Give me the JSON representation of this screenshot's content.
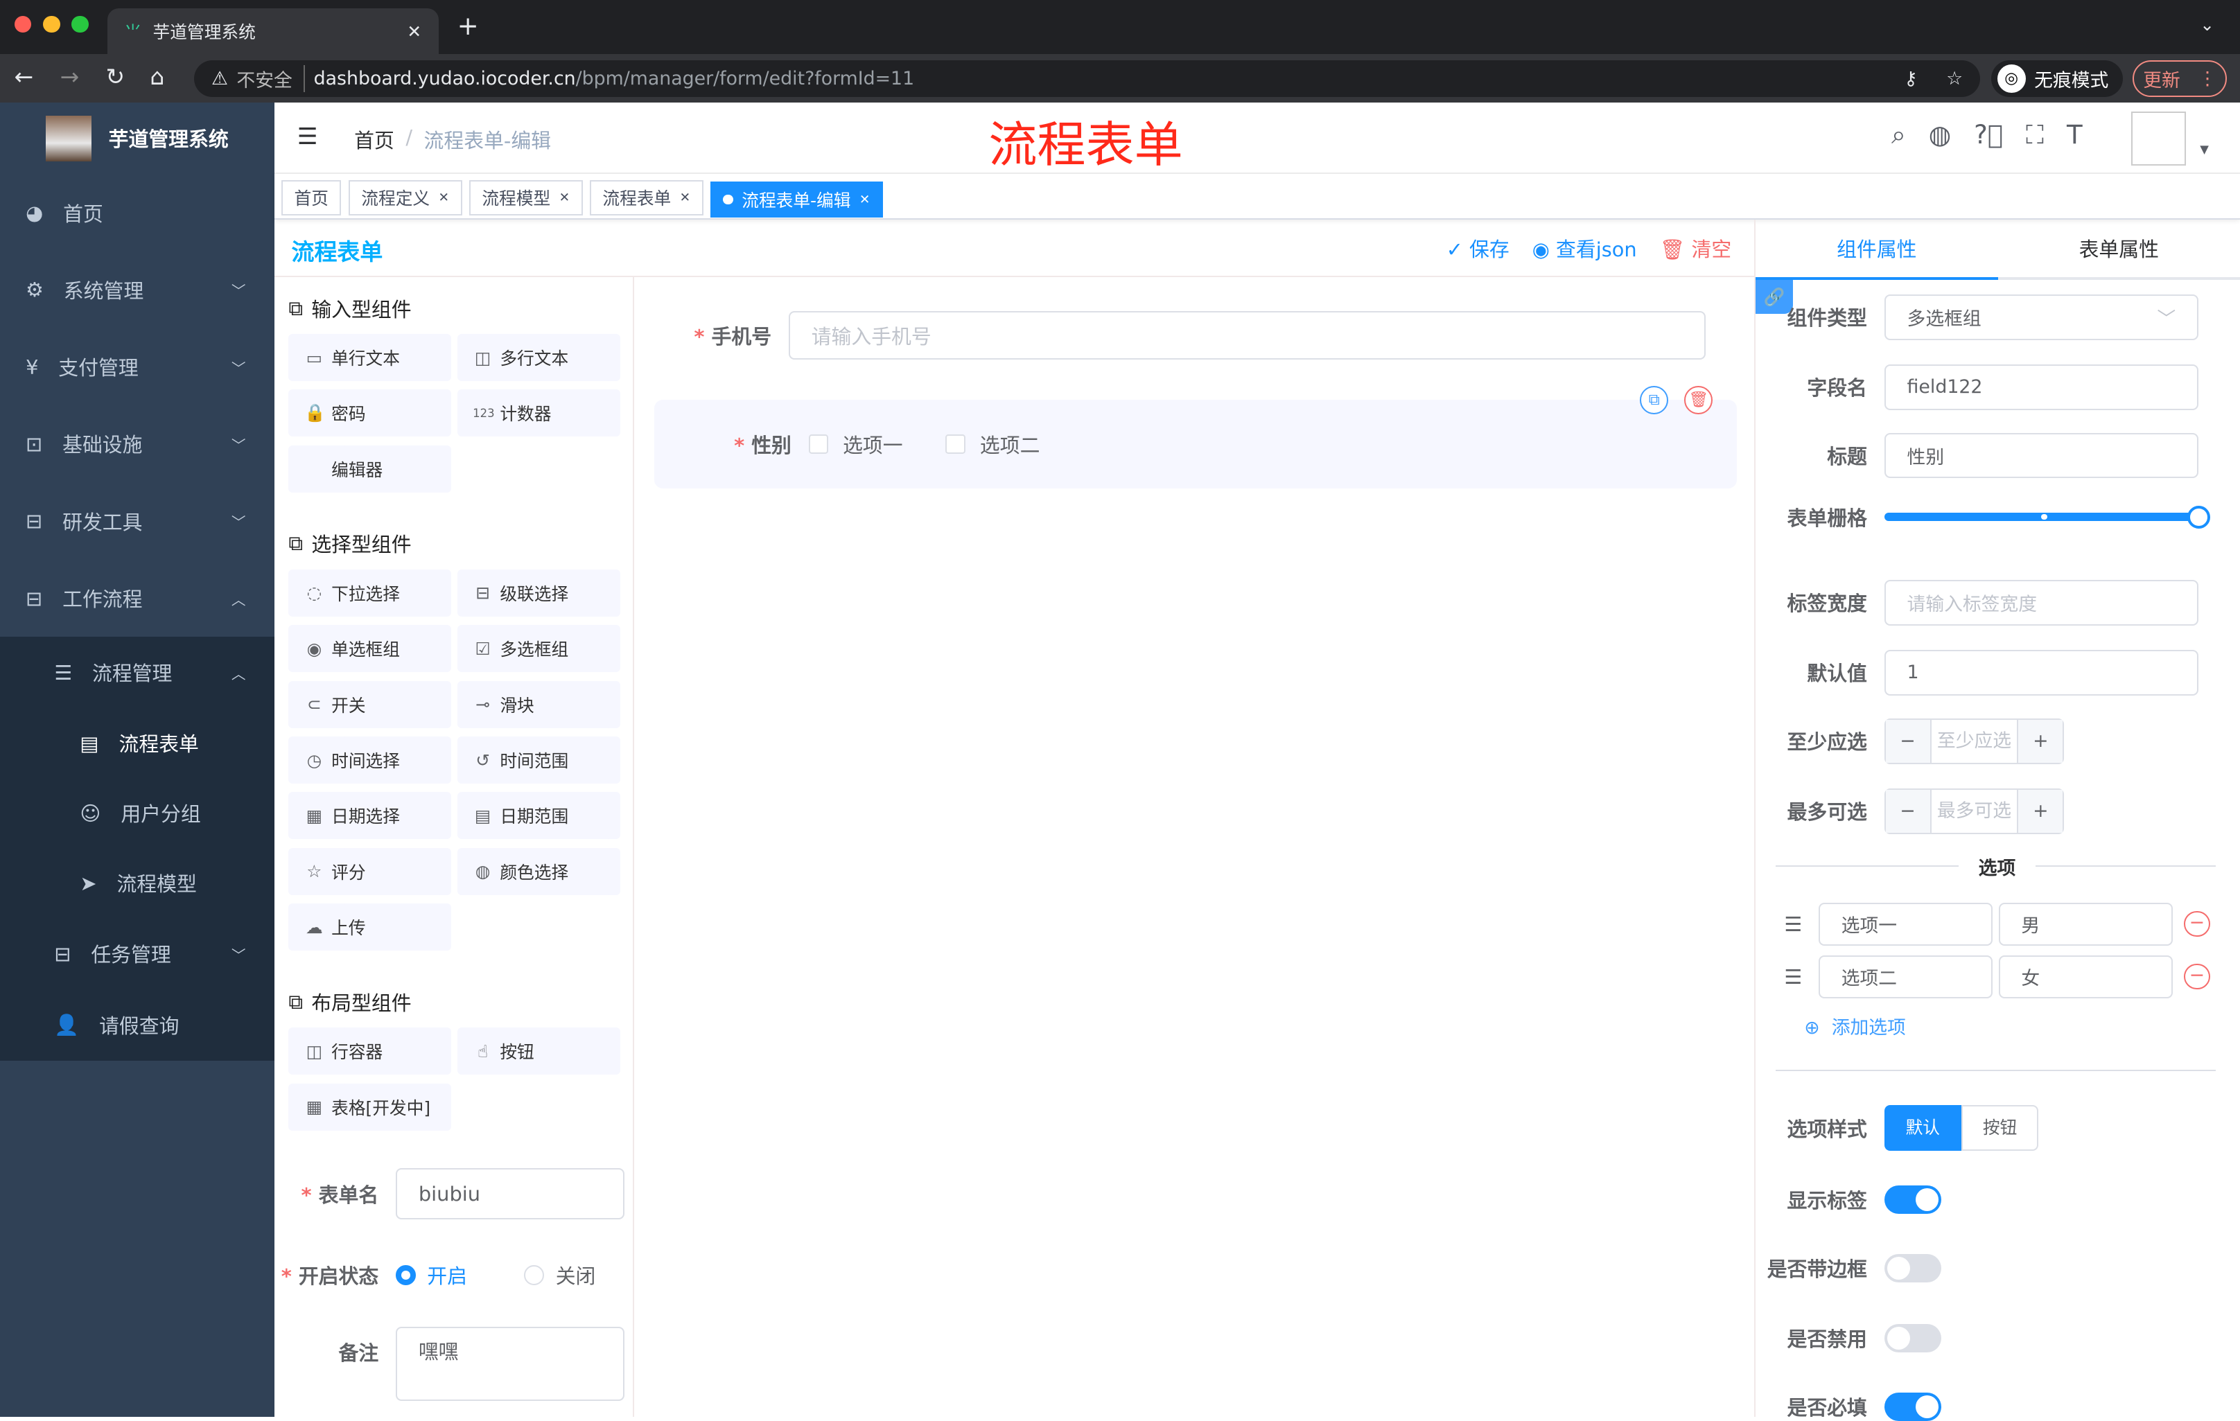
{
  "browser": {
    "tab_title": "芋道管理系统",
    "insecure": "不安全",
    "url_host": "dashboard.yudao.iocoder.cn",
    "url_path": "/bpm/manager/form/edit?formId=11",
    "incognito": "无痕模式",
    "update": "更新"
  },
  "sidebar": {
    "title": "芋道管理系统",
    "items": [
      {
        "label": "首页",
        "icon": "dashboard-icon"
      },
      {
        "label": "系统管理",
        "icon": "gear-icon"
      },
      {
        "label": "支付管理",
        "icon": "yen-icon"
      },
      {
        "label": "基础设施",
        "icon": "monitor-icon"
      },
      {
        "label": "研发工具",
        "icon": "toolbox-icon"
      },
      {
        "label": "工作流程",
        "icon": "toolbox-icon"
      }
    ],
    "sub": {
      "label": "流程管理",
      "children": [
        {
          "label": "流程表单"
        },
        {
          "label": "用户分组"
        },
        {
          "label": "流程模型"
        }
      ]
    },
    "after": [
      {
        "label": "任务管理"
      },
      {
        "label": "请假查询"
      }
    ]
  },
  "header": {
    "breadcrumb": [
      "首页",
      "流程表单-编辑"
    ],
    "annotation": "流程表单"
  },
  "tags": [
    {
      "label": "首页",
      "closable": false
    },
    {
      "label": "流程定义",
      "closable": true
    },
    {
      "label": "流程模型",
      "closable": true
    },
    {
      "label": "流程表单",
      "closable": true
    },
    {
      "label": "流程表单-编辑",
      "closable": true,
      "active": true
    }
  ],
  "left": {
    "title": "流程表单",
    "groups": [
      {
        "title": "输入型组件",
        "items": [
          {
            "l": "单行文本",
            "i": "▭"
          },
          {
            "l": "多行文本",
            "i": "◫"
          },
          {
            "l": "密码",
            "i": "🔒"
          },
          {
            "l": "计数器",
            "i": "123"
          },
          {
            "l": "编辑器",
            "i": ""
          }
        ]
      },
      {
        "title": "选择型组件",
        "items": [
          {
            "l": "下拉选择",
            "i": "◌"
          },
          {
            "l": "级联选择",
            "i": "⊟"
          },
          {
            "l": "单选框组",
            "i": "◉"
          },
          {
            "l": "多选框组",
            "i": "☑"
          },
          {
            "l": "开关",
            "i": "⊂"
          },
          {
            "l": "滑块",
            "i": "⊸"
          },
          {
            "l": "时间选择",
            "i": "◷"
          },
          {
            "l": "时间范围",
            "i": "↺"
          },
          {
            "l": "日期选择",
            "i": "▦"
          },
          {
            "l": "日期范围",
            "i": "▤"
          },
          {
            "l": "评分",
            "i": "☆"
          },
          {
            "l": "颜色选择",
            "i": "◍"
          },
          {
            "l": "上传",
            "i": "☁"
          }
        ]
      },
      {
        "title": "布局型组件",
        "items": [
          {
            "l": "行容器",
            "i": "◫"
          },
          {
            "l": "按钮",
            "i": "☝"
          },
          {
            "l": "表格[开发中]",
            "i": "▦"
          }
        ]
      }
    ],
    "form": {
      "name_label": "表单名",
      "name_value": "biubiu",
      "status_label": "开启状态",
      "status_on": "开启",
      "status_off": "关闭",
      "remark_label": "备注",
      "remark_value": "嘿嘿"
    }
  },
  "toolbar": {
    "save": "保存",
    "json": "查看json",
    "clear": "清空"
  },
  "canvas": {
    "phone_label": "手机号",
    "phone_placeholder": "请输入手机号",
    "gender_label": "性别",
    "options": [
      "选项一",
      "选项二"
    ]
  },
  "right": {
    "tabs": [
      "组件属性",
      "表单属性"
    ],
    "type_label": "组件类型",
    "type_value": "多选框组",
    "field_label": "字段名",
    "field_value": "field122",
    "title_label": "标题",
    "title_value": "性别",
    "span_label": "表单栅格",
    "span_value": 24,
    "span_max": 24,
    "labelw_label": "标签宽度",
    "labelw_placeholder": "请输入标签宽度",
    "default_label": "默认值",
    "default_value": "1",
    "min_label": "至少应选",
    "min_placeholder": "至少应选",
    "max_label": "最多可选",
    "max_placeholder": "最多可选",
    "options_title": "选项",
    "options": [
      {
        "label": "选项一",
        "value": "男"
      },
      {
        "label": "选项二",
        "value": "女"
      }
    ],
    "add_option": "添加选项",
    "style_label": "选项样式",
    "style_options": [
      "默认",
      "按钮"
    ],
    "show_label": "显示标签",
    "show_value": true,
    "border_label": "是否带边框",
    "border_value": false,
    "disabled_label": "是否禁用",
    "disabled_value": false,
    "required_label": "是否必填",
    "required_value": true
  },
  "colors": {
    "primary": "#1890ff",
    "sidebar": "#304156",
    "danger": "#f56c6c",
    "annotation": "#ff2a1a"
  }
}
